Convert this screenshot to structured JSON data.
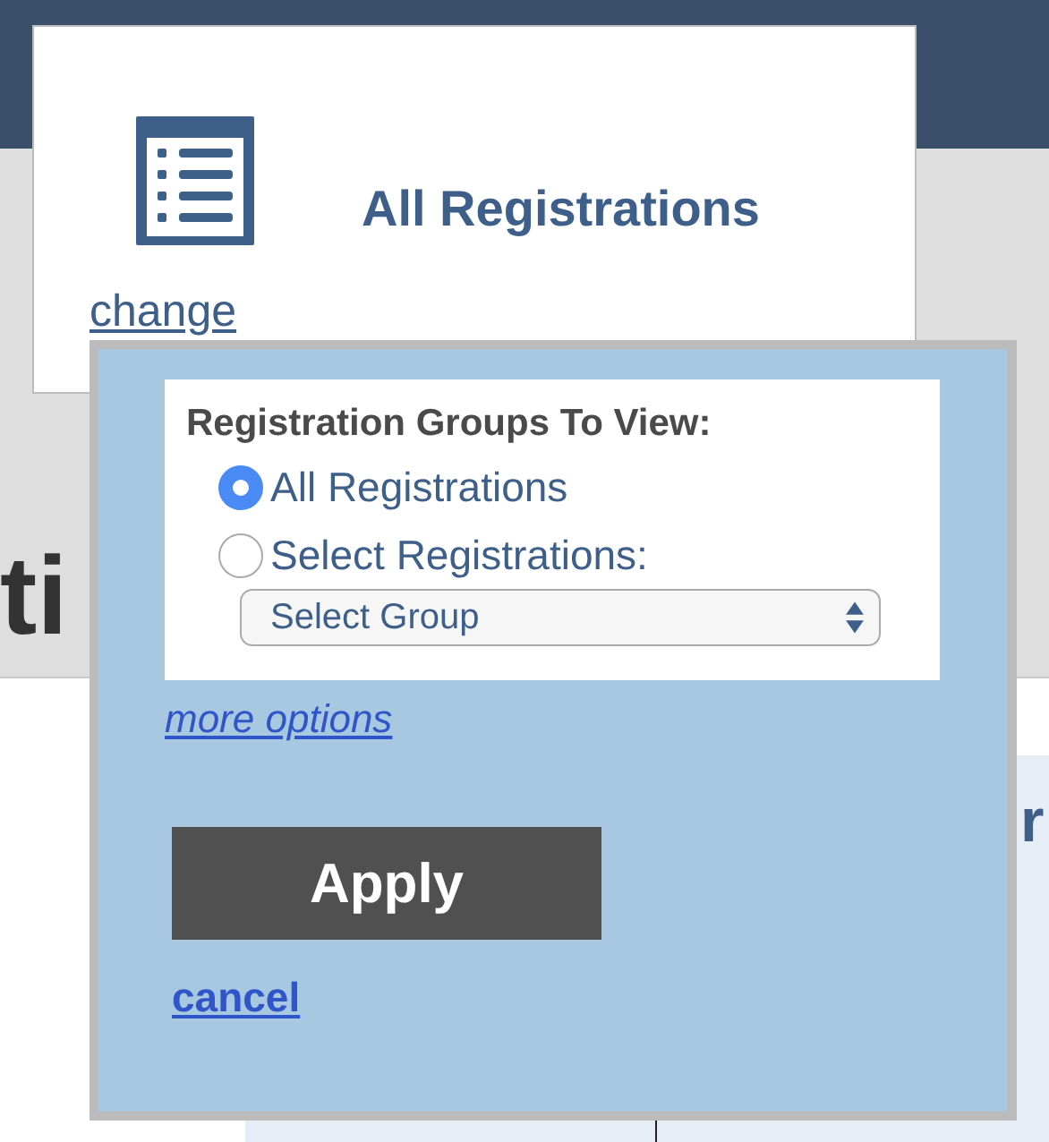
{
  "header_card": {
    "title": "All Registrations",
    "change_link": "change"
  },
  "background": {
    "heading_fragment": "ti",
    "side_fragment": "r"
  },
  "popup": {
    "group_heading": "Registration Groups To View:",
    "options": [
      {
        "label": "All Registrations",
        "selected": true
      },
      {
        "label": "Select Registrations:",
        "selected": false
      }
    ],
    "group_select": {
      "value": "Select Group"
    },
    "more_options": "more options",
    "apply": "Apply",
    "cancel": "cancel"
  }
}
